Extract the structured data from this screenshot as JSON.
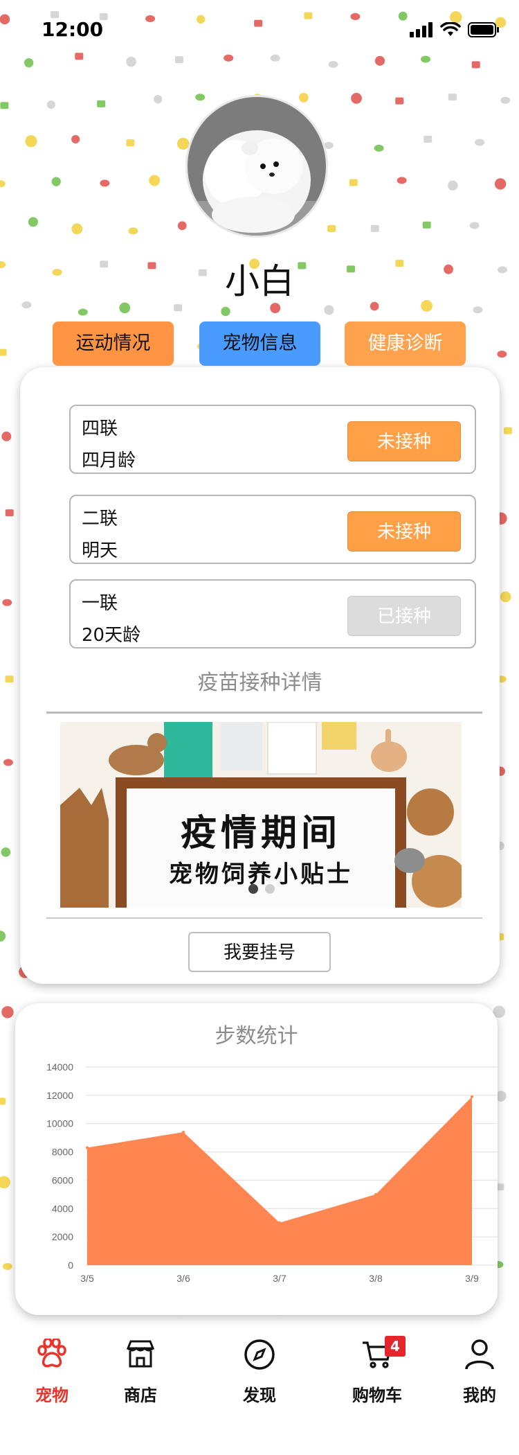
{
  "status_bar": {
    "time": "12:00"
  },
  "profile": {
    "pet_name": "小白"
  },
  "tabs": [
    {
      "label": "运动情况"
    },
    {
      "label": "宠物信息"
    },
    {
      "label": "健康诊断"
    }
  ],
  "vaccines": [
    {
      "name": "四联",
      "age": "四月龄",
      "status": "未接种"
    },
    {
      "name": "二联",
      "age": "明天",
      "status": "未接种"
    },
    {
      "name": "一联",
      "age": "20天龄",
      "status": "已接种"
    }
  ],
  "vaccine_detail_title": "疫苗接种详情",
  "banner": {
    "line1": "疫情期间",
    "line2": "宠物饲养小贴士"
  },
  "register_button": "我要挂号",
  "steps_card": {
    "title": "步数统计"
  },
  "chart_data": {
    "type": "area",
    "title": "步数统计",
    "categories": [
      "3/5",
      "3/6",
      "3/7",
      "3/8",
      "3/9"
    ],
    "values": [
      8300,
      9400,
      3000,
      5000,
      11900
    ],
    "ylim": [
      0,
      14000
    ],
    "yticks": [
      "0",
      "2000",
      "4000",
      "6000",
      "8000",
      "10000",
      "12000",
      "14000"
    ],
    "grid": true,
    "color": "#ff8651"
  },
  "nav": [
    {
      "label": "宠物",
      "icon": "paw-icon",
      "active": true
    },
    {
      "label": "商店",
      "icon": "store-icon"
    },
    {
      "label": "发现",
      "icon": "compass-icon"
    },
    {
      "label": "购物车",
      "icon": "cart-icon",
      "badge": "4"
    },
    {
      "label": "我的",
      "icon": "user-icon"
    }
  ],
  "colors": {
    "accent_orange": "#ffa047",
    "accent_blue": "#4a9bff",
    "nav_active": "#e8342a"
  }
}
